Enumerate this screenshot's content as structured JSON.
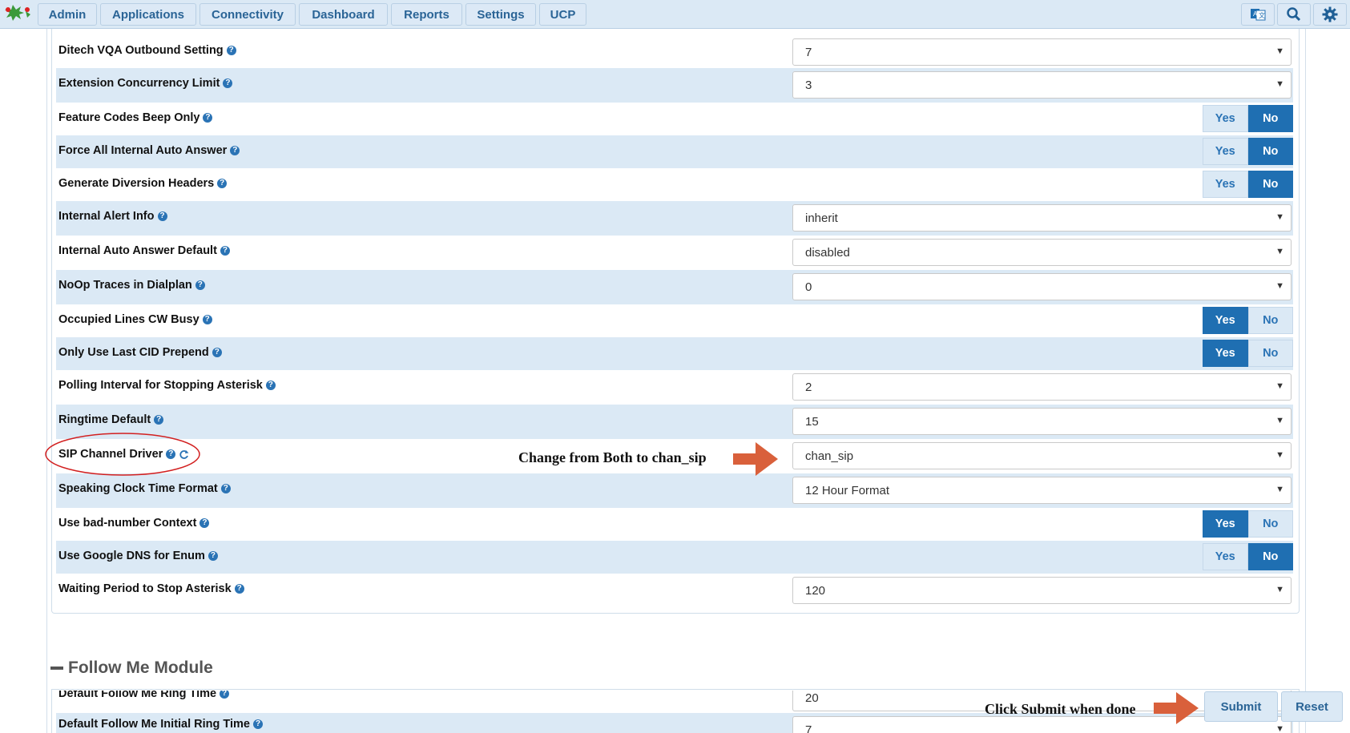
{
  "nav": {
    "items": [
      "Admin",
      "Applications",
      "Connectivity",
      "Dashboard",
      "Reports",
      "Settings",
      "UCP"
    ],
    "icons": [
      "translate-icon",
      "search-icon",
      "gear-icon"
    ]
  },
  "settings": [
    {
      "label": "Ditech VQA Outbound Setting",
      "type": "select",
      "value": "7"
    },
    {
      "label": "Extension Concurrency Limit",
      "type": "select",
      "value": "3"
    },
    {
      "label": "Feature Codes Beep Only",
      "type": "toggle",
      "yes": "Yes",
      "no": "No",
      "selected": "No"
    },
    {
      "label": "Force All Internal Auto Answer",
      "type": "toggle",
      "yes": "Yes",
      "no": "No",
      "selected": "No"
    },
    {
      "label": "Generate Diversion Headers",
      "type": "toggle",
      "yes": "Yes",
      "no": "No",
      "selected": "No"
    },
    {
      "label": "Internal Alert Info",
      "type": "select",
      "value": "inherit"
    },
    {
      "label": "Internal Auto Answer Default",
      "type": "select",
      "value": "disabled"
    },
    {
      "label": "NoOp Traces in Dialplan",
      "type": "select",
      "value": "0"
    },
    {
      "label": "Occupied Lines CW Busy",
      "type": "toggle",
      "yes": "Yes",
      "no": "No",
      "selected": "Yes"
    },
    {
      "label": "Only Use Last CID Prepend",
      "type": "toggle",
      "yes": "Yes",
      "no": "No",
      "selected": "Yes"
    },
    {
      "label": "Polling Interval for Stopping Asterisk",
      "type": "select",
      "value": "2"
    },
    {
      "label": "Ringtime Default",
      "type": "select",
      "value": "15"
    },
    {
      "label": "SIP Channel Driver",
      "type": "select",
      "value": "chan_sip",
      "refresh": true
    },
    {
      "label": "Speaking Clock Time Format",
      "type": "select",
      "value": "12 Hour Format"
    },
    {
      "label": "Use bad-number Context",
      "type": "toggle",
      "yes": "Yes",
      "no": "No",
      "selected": "Yes"
    },
    {
      "label": "Use Google DNS for Enum",
      "type": "toggle",
      "yes": "Yes",
      "no": "No",
      "selected": "No"
    },
    {
      "label": "Waiting Period to Stop Asterisk",
      "type": "select",
      "value": "120"
    }
  ],
  "followme": {
    "title": "Follow Me Module",
    "rows": [
      {
        "label": "Default Follow Me Ring Time",
        "value": "20"
      },
      {
        "label": "Default Follow Me Initial Ring Time",
        "value": "7"
      }
    ]
  },
  "annotations": {
    "sip": "Change from Both to chan_sip",
    "submit": "Click Submit when done"
  },
  "buttons": {
    "submit": "Submit",
    "reset": "Reset"
  },
  "colors": {
    "accent": "#1f6fb2",
    "row_alt": "#dbe9f5",
    "annotation_arrow": "#d9603b",
    "circle": "#d22020"
  }
}
